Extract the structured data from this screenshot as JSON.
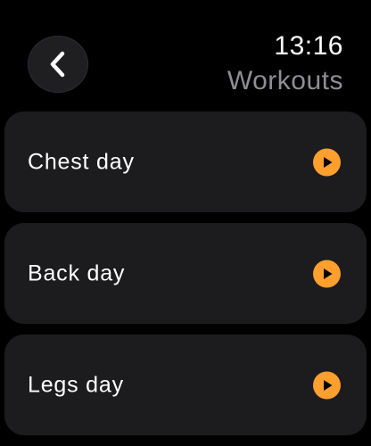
{
  "status": {
    "time": "13:16"
  },
  "header": {
    "back_icon": "chevron-left-icon",
    "title": "Workouts"
  },
  "workouts": [
    {
      "label": "Chest day",
      "icon": "play-icon"
    },
    {
      "label": "Back day",
      "icon": "play-icon"
    },
    {
      "label": "Legs day",
      "icon": "play-icon"
    }
  ],
  "colors": {
    "background": "#000000",
    "card": "#1c1c1e",
    "accent": "#ff9f2e",
    "title": "#8e8e93",
    "text": "#ffffff"
  }
}
